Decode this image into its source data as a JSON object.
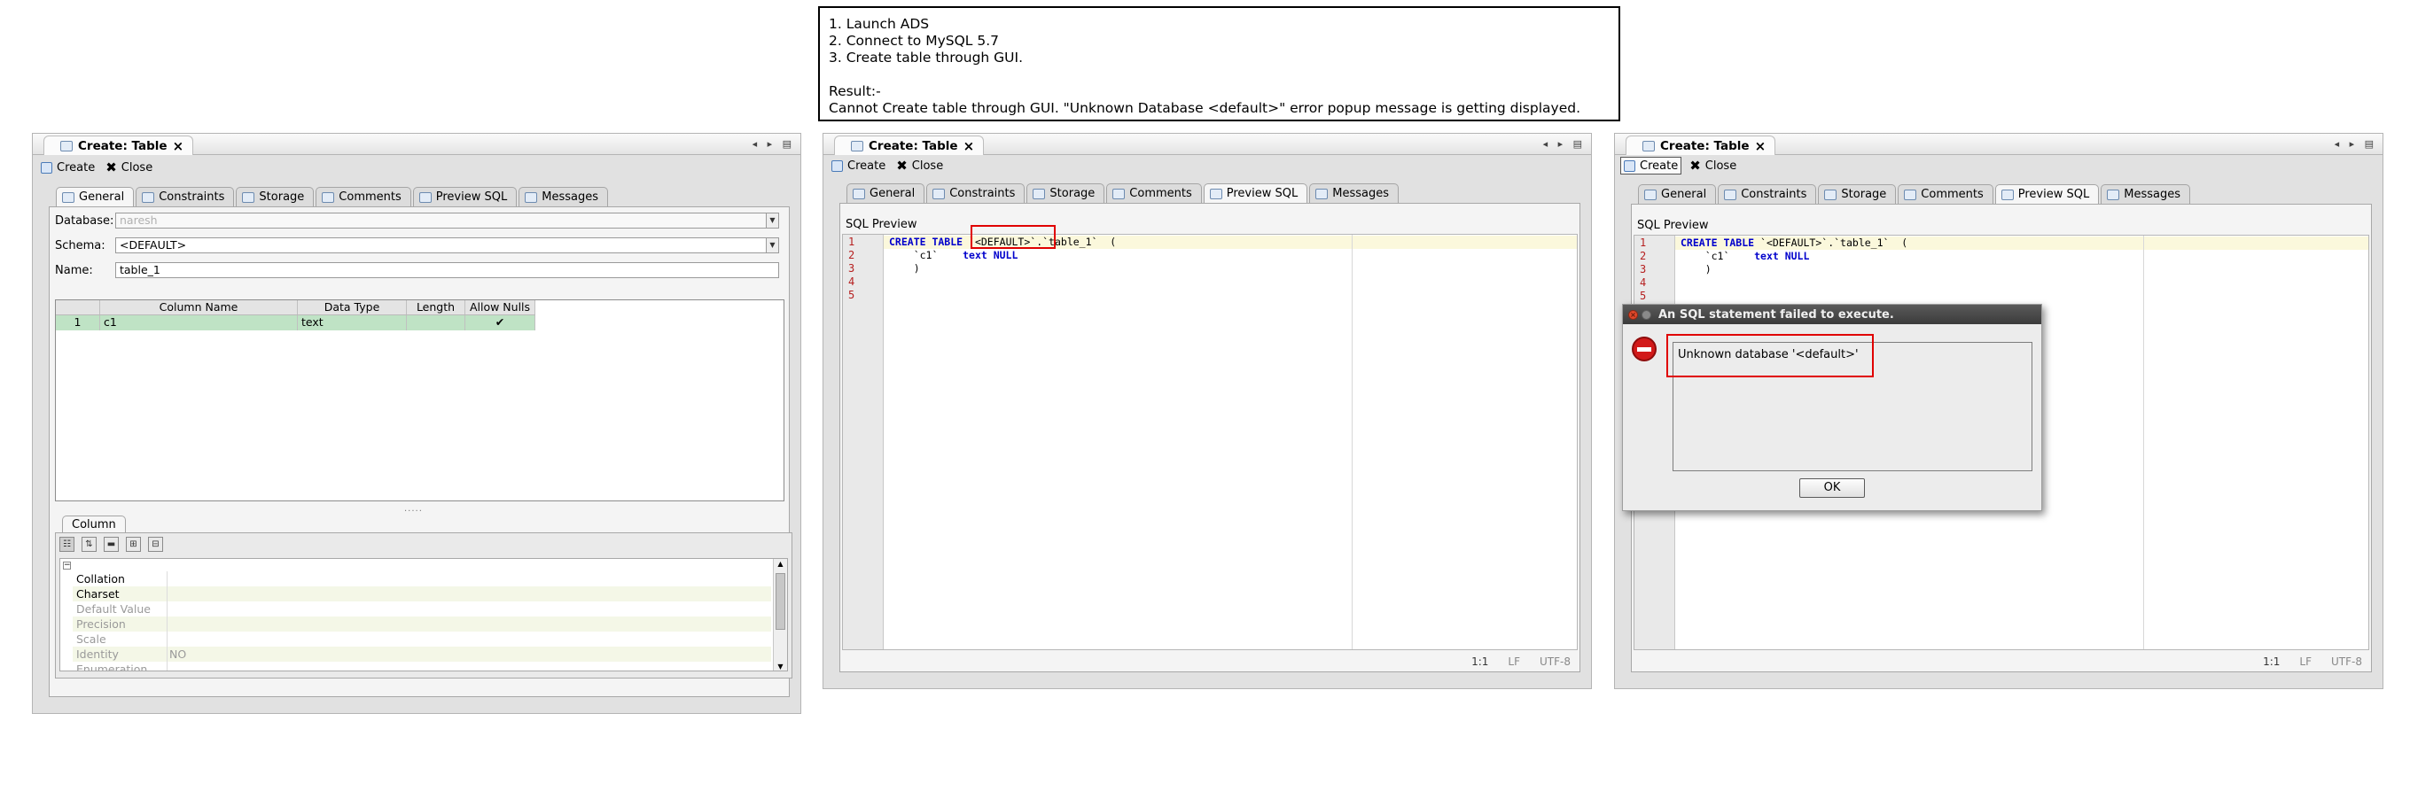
{
  "note": {
    "lines": [
      "1. Launch ADS",
      "2. Connect to MySQL 5.7",
      "3. Create table through GUI.",
      "",
      "Result:-",
      "Cannot Create table through GUI. \"Unknown Database <default>\" error popup message is getting displayed."
    ]
  },
  "editor_title": "Create: Table",
  "toolbar": {
    "create_label": "Create",
    "close_label": "Close"
  },
  "tabs": [
    "General",
    "Constraints",
    "Storage",
    "Comments",
    "Preview SQL",
    "Messages"
  ],
  "general": {
    "database_label": "Database:",
    "database_value": "naresh",
    "schema_label": "Schema:",
    "schema_value": "<DEFAULT>",
    "name_label": "Name:",
    "name_value": "table_1"
  },
  "columns_table": {
    "headers": [
      "",
      "Column Name",
      "Data Type",
      "Length",
      "Allow Nulls"
    ],
    "rows": [
      {
        "num": "1",
        "name": "c1",
        "type": "text",
        "length": "",
        "allow_nulls": "✔"
      }
    ]
  },
  "column_panel": {
    "tab_label": "Column",
    "properties": [
      {
        "key": "Collation",
        "value": ""
      },
      {
        "key": "Charset",
        "value": ""
      },
      {
        "key": "Default Value",
        "value": ""
      },
      {
        "key": "Precision",
        "value": ""
      },
      {
        "key": "Scale",
        "value": ""
      },
      {
        "key": "Identity",
        "value": "NO"
      },
      {
        "key": "Enumeration",
        "value": ""
      }
    ]
  },
  "preview": {
    "label": "SQL Preview",
    "line_numbers": [
      "1",
      "2",
      "3",
      "4",
      "5"
    ],
    "kw_create": "CREATE TABLE",
    "schema_token": "`<DEFAULT>`",
    "table_token": ".`table_1`  (",
    "col_token": "    `c1`    ",
    "kw_type": "text NULL",
    "close_token": "    )",
    "status": {
      "pos": "1:1",
      "eol": "LF",
      "enc": "UTF-8"
    }
  },
  "dialog": {
    "title": "An SQL statement failed to execute.",
    "message": "Unknown database '<default>'",
    "ok_label": "OK"
  },
  "colors": {
    "error_highlight": "#e00000",
    "grid_selection": "#bfe3c5",
    "keyword": "#0000cc"
  }
}
